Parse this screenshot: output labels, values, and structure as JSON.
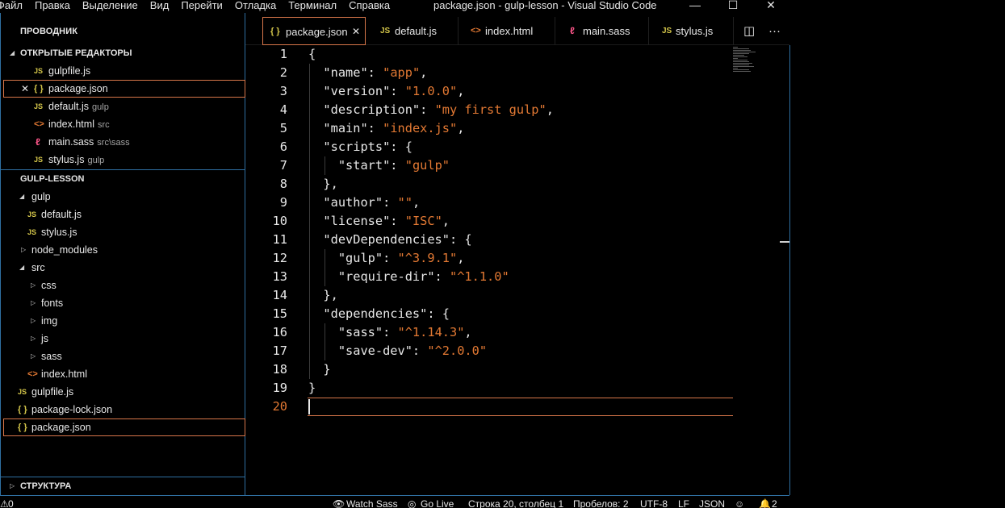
{
  "titlebar": {
    "menu": [
      "Файл",
      "Правка",
      "Выделение",
      "Вид",
      "Перейти",
      "Отладка",
      "Терминал",
      "Справка"
    ],
    "title": "package.json - gulp-lesson - Visual Studio Code",
    "minimize": "—",
    "maximize": "☐",
    "close": "✕"
  },
  "sidebar": {
    "explorer_title": "ПРОВОДНИК",
    "open_editors_title": "ОТКРЫТЫЕ РЕДАКТОРЫ",
    "open_editors": [
      {
        "icon": "JS",
        "name": "gulpfile.js",
        "desc": ""
      },
      {
        "icon": "{ }",
        "name": "package.json",
        "desc": ""
      },
      {
        "icon": "JS",
        "name": "default.js",
        "desc": "gulp"
      },
      {
        "icon": "<>",
        "name": "index.html",
        "desc": "src"
      },
      {
        "icon": "sass",
        "name": "main.sass",
        "desc": "src\\sass"
      },
      {
        "icon": "JS",
        "name": "stylus.js",
        "desc": "gulp"
      }
    ],
    "project_title": "GULP-LESSON",
    "tree": [
      {
        "icon": "",
        "name": "gulp",
        "twisty": "open"
      },
      {
        "icon": "JS",
        "name": "default.js"
      },
      {
        "icon": "JS",
        "name": "stylus.js"
      },
      {
        "icon": "",
        "name": "node_modules",
        "twisty": "closed"
      },
      {
        "icon": "",
        "name": "src",
        "twisty": "open"
      },
      {
        "icon": "",
        "name": "css",
        "twisty": "closed"
      },
      {
        "icon": "",
        "name": "fonts",
        "twisty": "closed"
      },
      {
        "icon": "",
        "name": "img",
        "twisty": "closed"
      },
      {
        "icon": "",
        "name": "js",
        "twisty": "closed"
      },
      {
        "icon": "",
        "name": "sass",
        "twisty": "closed"
      },
      {
        "icon": "<>",
        "name": "index.html"
      },
      {
        "icon": "JS",
        "name": "gulpfile.js"
      },
      {
        "icon": "{ }",
        "name": "package-lock.json"
      },
      {
        "icon": "{ }",
        "name": "package.json"
      }
    ],
    "outline_title": "СТРУКТУРА"
  },
  "tabs": [
    {
      "icon": "{ }",
      "label": "package.json",
      "active": true
    },
    {
      "icon": "JS",
      "label": "default.js"
    },
    {
      "icon": "<>",
      "label": "index.html"
    },
    {
      "icon": "sass",
      "label": "main.sass"
    },
    {
      "icon": "JS",
      "label": "stylus.js"
    }
  ],
  "tab_close": "✕",
  "tab_actions": {
    "split": "◫",
    "more": "···"
  },
  "editor": {
    "line_numbers": [
      "1",
      "2",
      "3",
      "4",
      "5",
      "6",
      "7",
      "8",
      "9",
      "10",
      "11",
      "12",
      "13",
      "14",
      "15",
      "16",
      "17",
      "18",
      "19",
      "20"
    ],
    "current_line": 20,
    "lines": [
      {
        "k": "{",
        "s": "",
        "e": ""
      },
      {
        "k": "  \"name\": ",
        "s": "\"app\"",
        "e": ","
      },
      {
        "k": "  \"version\": ",
        "s": "\"1.0.0\"",
        "e": ","
      },
      {
        "k": "  \"description\": ",
        "s": "\"my first gulp\"",
        "e": ","
      },
      {
        "k": "  \"main\": ",
        "s": "\"index.js\"",
        "e": ","
      },
      {
        "k": "  \"scripts\": {",
        "s": "",
        "e": ""
      },
      {
        "k": "    \"start\": ",
        "s": "\"gulp\"",
        "e": ""
      },
      {
        "k": "  },",
        "s": "",
        "e": ""
      },
      {
        "k": "  \"author\": ",
        "s": "\"\"",
        "e": ","
      },
      {
        "k": "  \"license\": ",
        "s": "\"ISC\"",
        "e": ","
      },
      {
        "k": "  \"devDependencies\": {",
        "s": "",
        "e": ""
      },
      {
        "k": "    \"gulp\": ",
        "s": "\"^3.9.1\"",
        "e": ","
      },
      {
        "k": "    \"require-dir\": ",
        "s": "\"^1.1.0\"",
        "e": ""
      },
      {
        "k": "  },",
        "s": "",
        "e": ""
      },
      {
        "k": "  \"dependencies\": {",
        "s": "",
        "e": ""
      },
      {
        "k": "    \"sass\": ",
        "s": "\"^1.14.3\"",
        "e": ","
      },
      {
        "k": "    \"save-dev\": ",
        "s": "\"^2.0.0\"",
        "e": ""
      },
      {
        "k": "  }",
        "s": "",
        "e": ""
      },
      {
        "k": "}",
        "s": "",
        "e": ""
      },
      {
        "k": "",
        "s": "",
        "e": ""
      }
    ]
  },
  "statusbar": {
    "problems": "0",
    "watch_sass": "Watch Sass",
    "go_live": "Go Live",
    "cursor": "Строка 20, столбец 1",
    "spaces": "Пробелов: 2",
    "encoding": "UTF-8",
    "eol": "LF",
    "language": "JSON",
    "notifications": "2"
  },
  "colors": {
    "accent": "#d7764a",
    "border": "#2f6fa1",
    "string": "#e37933",
    "js_icon": "#d4c64a"
  }
}
